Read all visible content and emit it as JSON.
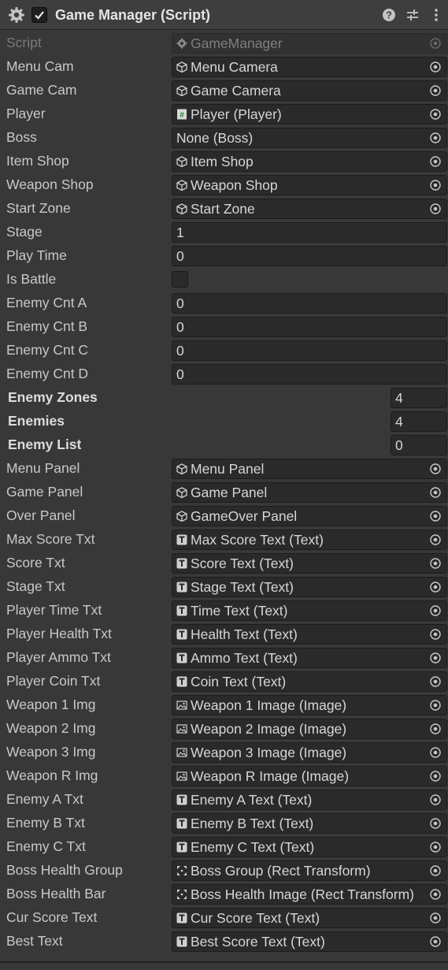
{
  "component": {
    "title": "Game Manager (Script)",
    "icon": "gear-icon",
    "enabled": true,
    "buttons": [
      "help-icon",
      "preset-icon",
      "more-icon"
    ]
  },
  "rows": [
    {
      "label": "Script",
      "value": "GameManager",
      "icon": "script",
      "kind": "disabled"
    },
    {
      "label": "Menu Cam",
      "value": "Menu Camera",
      "icon": "cube",
      "kind": "object"
    },
    {
      "label": "Game Cam",
      "value": "Game Camera",
      "icon": "cube",
      "kind": "object"
    },
    {
      "label": "Player",
      "value": "Player (Player)",
      "icon": "csharp",
      "kind": "object"
    },
    {
      "label": "Boss",
      "value": "None (Boss)",
      "icon": "",
      "kind": "object"
    },
    {
      "label": "Item Shop",
      "value": "Item Shop",
      "icon": "cube",
      "kind": "object"
    },
    {
      "label": "Weapon Shop",
      "value": "Weapon Shop",
      "icon": "cube",
      "kind": "object"
    },
    {
      "label": "Start Zone",
      "value": "Start Zone",
      "icon": "cube",
      "kind": "object"
    },
    {
      "label": "Stage",
      "value": "1",
      "kind": "number"
    },
    {
      "label": "Play Time",
      "value": "0",
      "kind": "number"
    },
    {
      "label": "Is Battle",
      "value": false,
      "kind": "bool"
    },
    {
      "label": "Enemy Cnt A",
      "value": "0",
      "kind": "number"
    },
    {
      "label": "Enemy Cnt B",
      "value": "0",
      "kind": "number"
    },
    {
      "label": "Enemy Cnt C",
      "value": "0",
      "kind": "number"
    },
    {
      "label": "Enemy Cnt D",
      "value": "0",
      "kind": "number"
    },
    {
      "label": "Enemy Zones",
      "value": "4",
      "kind": "array"
    },
    {
      "label": "Enemies",
      "value": "4",
      "kind": "array"
    },
    {
      "label": "Enemy List",
      "value": "0",
      "kind": "array"
    },
    {
      "label": "Menu Panel",
      "value": "Menu Panel",
      "icon": "cube",
      "kind": "object"
    },
    {
      "label": "Game Panel",
      "value": "Game Panel",
      "icon": "cube",
      "kind": "object"
    },
    {
      "label": "Over Panel",
      "value": "GameOver Panel",
      "icon": "cube",
      "kind": "object"
    },
    {
      "label": "Max Score Txt",
      "value": "Max Score Text (Text)",
      "icon": "text",
      "kind": "object"
    },
    {
      "label": "Score Txt",
      "value": "Score Text (Text)",
      "icon": "text",
      "kind": "object"
    },
    {
      "label": "Stage Txt",
      "value": "Stage Text (Text)",
      "icon": "text",
      "kind": "object"
    },
    {
      "label": "Player Time Txt",
      "value": "Time Text (Text)",
      "icon": "text",
      "kind": "object"
    },
    {
      "label": "Player Health Txt",
      "value": "Health Text (Text)",
      "icon": "text",
      "kind": "object"
    },
    {
      "label": "Player Ammo Txt",
      "value": "Ammo Text (Text)",
      "icon": "text",
      "kind": "object"
    },
    {
      "label": "Player Coin Txt",
      "value": "Coin Text (Text)",
      "icon": "text",
      "kind": "object"
    },
    {
      "label": "Weapon 1 Img",
      "value": "Weapon 1 Image (Image)",
      "icon": "image",
      "kind": "object"
    },
    {
      "label": "Weapon 2 Img",
      "value": "Weapon 2 Image (Image)",
      "icon": "image",
      "kind": "object"
    },
    {
      "label": "Weapon 3 Img",
      "value": "Weapon 3 Image (Image)",
      "icon": "image",
      "kind": "object"
    },
    {
      "label": "Weapon R Img",
      "value": "Weapon R Image (Image)",
      "icon": "image",
      "kind": "object"
    },
    {
      "label": "Enemy A Txt",
      "value": "Enemy A Text (Text)",
      "icon": "text",
      "kind": "object"
    },
    {
      "label": "Enemy B Txt",
      "value": "Enemy B Text (Text)",
      "icon": "text",
      "kind": "object"
    },
    {
      "label": "Enemy C Txt",
      "value": "Enemy C Text (Text)",
      "icon": "text",
      "kind": "object"
    },
    {
      "label": "Boss Health Group",
      "value": "Boss Group (Rect Transform)",
      "icon": "rect",
      "kind": "object"
    },
    {
      "label": "Boss Health Bar",
      "value": "Boss Health Image (Rect Transform)",
      "icon": "rect",
      "kind": "object"
    },
    {
      "label": "Cur Score Text",
      "value": "Cur Score Text (Text)",
      "icon": "text",
      "kind": "object"
    },
    {
      "label": "Best Text",
      "value": "Best Score Text (Text)",
      "icon": "text",
      "kind": "object"
    }
  ]
}
